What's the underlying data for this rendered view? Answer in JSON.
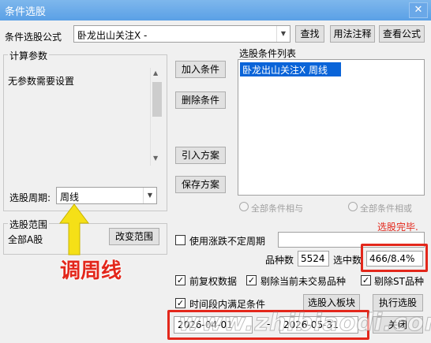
{
  "window": {
    "title": "条件选股",
    "close_glyph": "✕"
  },
  "formula": {
    "label": "条件选股公式",
    "value": "卧龙出山关注X  -",
    "find_button": "查找",
    "usage_button": "用法注释",
    "view_button": "查看公式"
  },
  "params": {
    "group_label": "计算参数",
    "message": "无参数需要设置",
    "period_label": "选股周期:",
    "period_value": "周线"
  },
  "actions": {
    "add": "加入条件",
    "delete": "删除条件",
    "import": "引入方案",
    "save": "保存方案"
  },
  "condition_list": {
    "label": "选股条件列表",
    "items": [
      "卧龙出山关注X  周线"
    ]
  },
  "logic": {
    "and_label": "全部条件相与",
    "or_label": "全部条件相或"
  },
  "status": {
    "text": "选股完毕.",
    "color": "#e3271b"
  },
  "range": {
    "group_label": "选股范围",
    "value": "全部A股",
    "change_button": "改变范围"
  },
  "options": {
    "uncertain_period": "使用涨跌不定周期",
    "forward_adjust": "前复权数据",
    "exclude_untraded": "剔除当前未交易品种",
    "exclude_st": "剔除ST品种",
    "time_range": "时间段内满足条件"
  },
  "counts": {
    "total_label": "品种数",
    "total_value": "5524",
    "selected_label": "选中数",
    "selected_value": "466/8.4%"
  },
  "buttons": {
    "to_block": "选股入板块",
    "execute": "执行选股",
    "close": "关闭"
  },
  "dates": {
    "start": "2026-04-01",
    "separator": "-",
    "end": "2026-05-31"
  },
  "annotation": {
    "text": "调周线",
    "color": "#e3271b",
    "arrow_color": "#f5e017"
  },
  "watermark": {
    "text": "www.zhibiaodi.com"
  }
}
